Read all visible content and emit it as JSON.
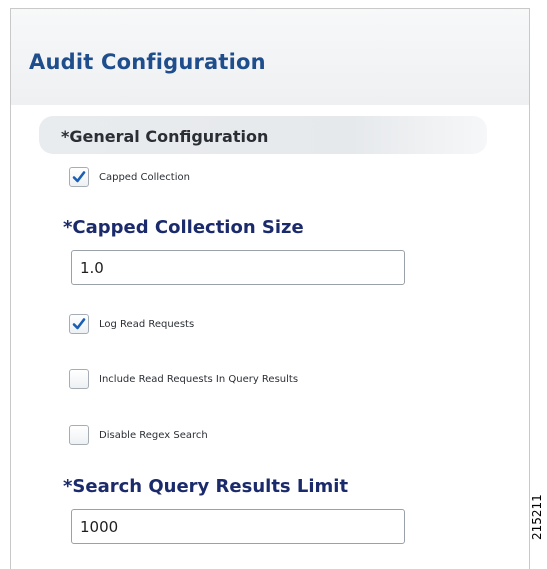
{
  "page": {
    "title": "Audit Configuration"
  },
  "section": {
    "title": "*General Configuration"
  },
  "form": {
    "capped_collection": {
      "label": "Capped Collection",
      "checked": true
    },
    "capped_collection_size": {
      "label": "*Capped Collection Size",
      "value": "1.0"
    },
    "log_read_requests": {
      "label": "Log Read Requests",
      "checked": true
    },
    "include_read_requests": {
      "label": "Include Read Requests In Query Results",
      "checked": false
    },
    "disable_regex_search": {
      "label": "Disable Regex Search",
      "checked": false
    },
    "search_query_results_limit": {
      "label": "*Search Query Results Limit",
      "value": "1000"
    }
  },
  "figure_id": "215211",
  "colors": {
    "title": "#1f4e8c",
    "field_label": "#1b2a6b",
    "check": "#1a5fb4"
  },
  "icons": {
    "check": "checkmark-icon"
  }
}
